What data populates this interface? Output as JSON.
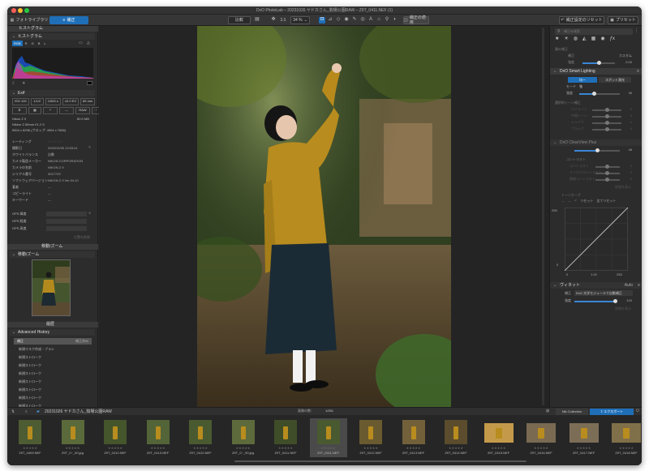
{
  "window": {
    "title": "DxO PhotoLab – 20231026 ヤドカさん_駒場公園RAW – Z9T_0411.NEF (1)"
  },
  "toolbar": {
    "tab_library": "フォトライブラリ",
    "tab_customize": "補正",
    "compare": "比較",
    "zoom_ratio": "1:1",
    "zoom": "34 %",
    "reset_button": "補正設定のリセット",
    "preset_button": "プリセット",
    "original_button": "補正の適用"
  },
  "left": {
    "histogram_title": "ヒストグラム",
    "hist_tabs": [
      "RGB",
      "R",
      "G",
      "B",
      "L"
    ],
    "exif_title": "Exif",
    "exif_chips": [
      "ISO 100",
      "1/1/2",
      "1/500 s",
      "±0.0 EV",
      "85 mm"
    ],
    "exif_chips2": [
      "",
      "",
      "---",
      "RAW",
      ""
    ],
    "camera": "Nikon Z 9",
    "filesize": "80.9 MB",
    "lens": "Nikkor Z 85mm f/1.2 S",
    "dimensions": "5504 x 8256 (クロップ: 4904 x 7656)",
    "meta_rows": [
      {
        "label": "レーティング",
        "value": "☆☆☆☆☆"
      },
      {
        "label": "撮影日",
        "value": "2023/10/26 13:03:41"
      },
      {
        "label": "ホワイトバランス",
        "value": "自動"
      },
      {
        "label": "カメラ製造メーカー",
        "value": "NIKON CORPORATION"
      },
      {
        "label": "カメラの名前",
        "value": "NIKON Z 9"
      },
      {
        "label": "シリアル番号",
        "value": "3017729"
      },
      {
        "label": "ソフトウェアバージョン",
        "value": "NIKON Z 9 Ver.04.10"
      },
      {
        "label": "著者",
        "value": "---"
      },
      {
        "label": "コピーライト",
        "value": "---"
      },
      {
        "label": "キーワード",
        "value": "---"
      }
    ],
    "gps_rows": [
      "GPS 緯度",
      "GPS 経度",
      "GPS 高度"
    ],
    "gps_link": "位置を削除",
    "nav_title": "移動/ズーム",
    "nav_sub": "移動/ズーム",
    "history_title": "履歴",
    "history_sub": "Advanced History",
    "history_first": "補正",
    "history_first_right": "補正済み",
    "history_items": [
      "新規マスク作成・ブラシ",
      "新規ストローク",
      "新規ストローク",
      "新規ストローク",
      "新規ストローク",
      "新規ストローク",
      "新規ストローク",
      "新規ストローク"
    ]
  },
  "right": {
    "search_placeholder": "補正を検索",
    "clear_view_title": "霧の補正",
    "cv_rows": [
      {
        "label": "補正",
        "value": "カスタム"
      },
      {
        "label": "強度",
        "value": "0.00"
      }
    ],
    "smart_title": "DxO Smart Lighting",
    "smart_tabs": [
      "均一",
      "スポット測光"
    ],
    "mode_label": "モード",
    "mode_value": "強",
    "strength_label": "強度",
    "strength_value": "36",
    "selective_title": "選択的トーン補正",
    "tone_rows": [
      {
        "label": "ハイライト",
        "value": "0"
      },
      {
        "label": "中間トーン",
        "value": "0"
      },
      {
        "label": "シャドウ",
        "value": "0"
      },
      {
        "label": "ブラック",
        "value": "0"
      }
    ],
    "clearview_title": "DxO ClearView Plus",
    "clearview_value": "48",
    "contrast_title": "コントラスト",
    "contrast_rows": [
      {
        "label": "コントラスト",
        "value": "0"
      },
      {
        "label": "マイクロコントラスト",
        "value": "0"
      },
      {
        "label": "微細コントラスト",
        "value": "0"
      }
    ],
    "contrast_link": "詳細を表示",
    "curve_title": "トーンカーブ",
    "curve_reset": "リセット",
    "curve_reset_all": "全てリセット",
    "curve_top": "255",
    "curve_bottom": "0",
    "curve_gamma": "1.00",
    "curve_right": "255",
    "vignette_title": "ヴィネット",
    "vignette_mode": "Auto",
    "vignette_module_label": "補正",
    "vignette_module": "DxO 光学モジュールで自動補正",
    "vignette_strength_label": "強度",
    "vignette_strength": "100",
    "vignette_link": "詳細を表示"
  },
  "filmbar": {
    "folder": "20231026 ヤドカさん_駒場公園RAW",
    "count_label": "画像の数：",
    "count": "1/251",
    "nik": "Nik Collection",
    "export": "エクスポート"
  },
  "thumbs": [
    {
      "name": "Z9T_0409.NEF"
    },
    {
      "name": "Z9T_0~_90.jpg"
    },
    {
      "name": "Z9T_0410.NEF"
    },
    {
      "name": "Z9T_0410.NEF"
    },
    {
      "name": "Z9T_0410.NEF"
    },
    {
      "name": "Z9T_0~_90.jpg"
    },
    {
      "name": "Z9T_0411.NEF"
    },
    {
      "name": "Z9T_0411.NEF"
    },
    {
      "name": "Z9T_0412.NEF"
    },
    {
      "name": "Z9T_0413.NEF"
    },
    {
      "name": "Z9T_0414.NEF"
    },
    {
      "name": "Z9T_0415.NEF"
    },
    {
      "name": "Z9T_0416.NEF"
    },
    {
      "name": "Z9T_0417.NEF"
    },
    {
      "name": "Z9T_0418.NEF"
    }
  ],
  "colors": {
    "accent": "#1f6fb8",
    "panel": "#2c2c2c"
  }
}
